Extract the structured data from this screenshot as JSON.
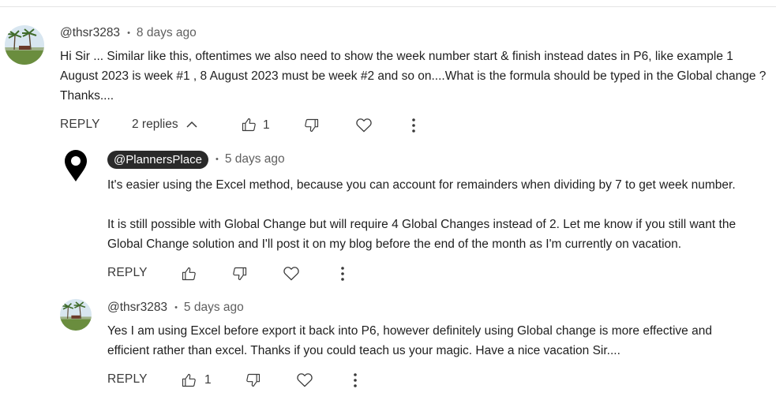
{
  "comments": [
    {
      "author": "@thsr3283",
      "time": "8 days ago",
      "text": "Hi Sir ... Similar like this, oftentimes we also need to show the week number start & finish instead dates in P6,  like example 1 August 2023 is week #1 , 8 August 2023 must be week #2 and so on....What is the formula  should be typed in the Global change ? Thanks....",
      "reply_label": "REPLY",
      "replies_label": "2 replies",
      "like_count": "1"
    }
  ],
  "replies": [
    {
      "author": "@PlannersPlace",
      "time": "5 days ago",
      "paragraph1": "It's easier using the Excel method, because you can account for remainders when dividing by 7 to get week number.",
      "paragraph2": "It is still possible with Global Change but will require 4 Global Changes instead of 2. Let me know if you still want the Global Change solution and I'll post it on my blog before the end of the month as I'm currently on vacation.",
      "reply_label": "REPLY"
    },
    {
      "author": "@thsr3283",
      "time": "5 days ago",
      "text": "Yes I am using Excel before export it back into P6, however definitely using Global change is more effective and efficient rather than  excel. Thanks if you could teach us your magic. Have a nice vacation Sir....",
      "reply_label": "REPLY",
      "like_count": "1"
    }
  ],
  "icons": {
    "separator_dot": "•",
    "like": "thumbs-up-icon",
    "dislike": "thumbs-down-icon",
    "heart": "heart-icon",
    "more": "more-vert-icon",
    "chevron": "chevron-up-icon",
    "author_avatar": "location-pin-icon"
  },
  "colors": {
    "text": "#1f1f1f",
    "meta": "#606060",
    "chip_bg": "#2a2a2a",
    "divider": "#e5e5e5"
  }
}
